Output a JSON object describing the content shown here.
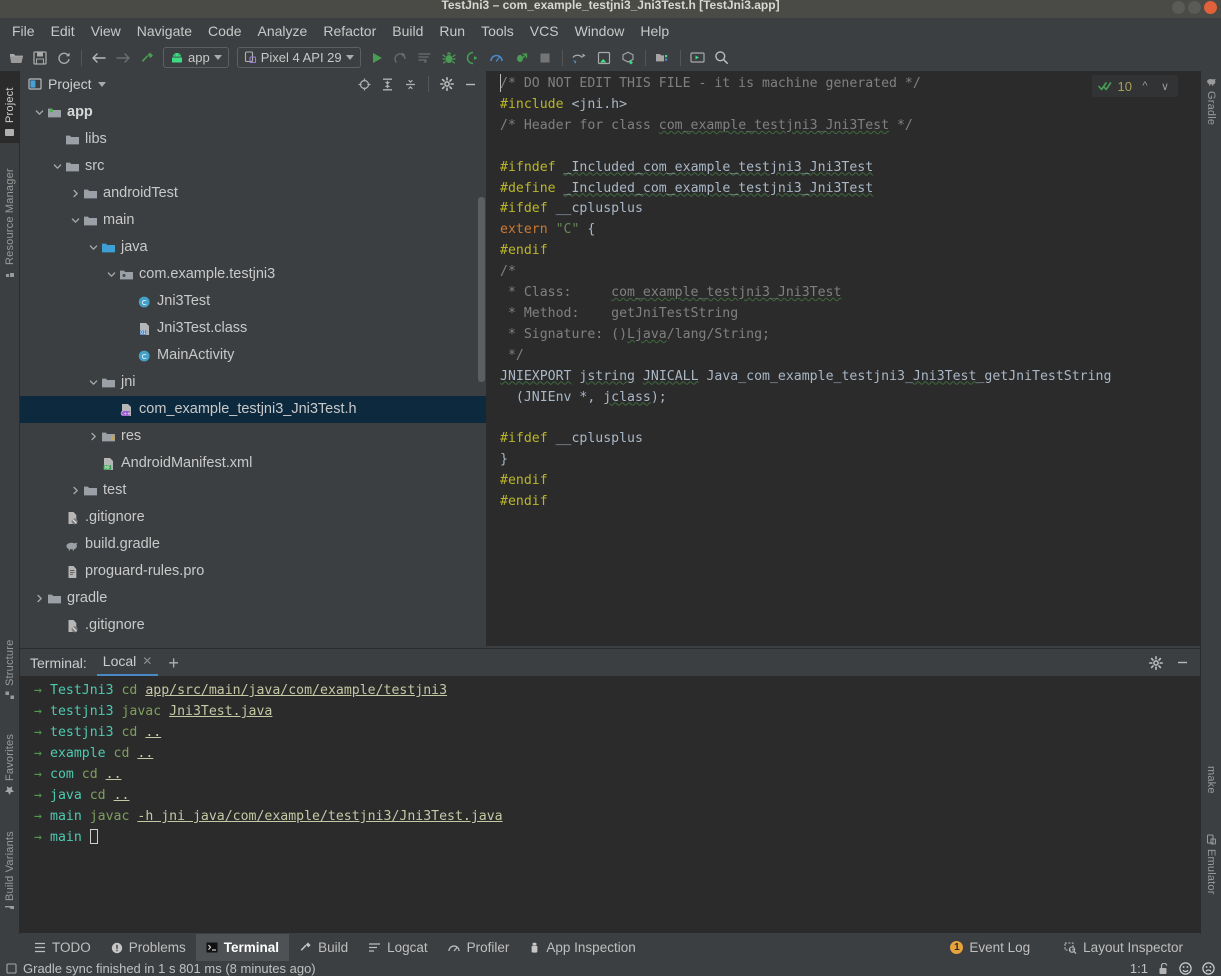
{
  "window": {
    "title": "TestJni3 – com_example_testjni3_Jni3Test.h [TestJni3.app]"
  },
  "menubar": {
    "items": [
      "File",
      "Edit",
      "View",
      "Navigate",
      "Code",
      "Analyze",
      "Refactor",
      "Build",
      "Run",
      "Tools",
      "VCS",
      "Window",
      "Help"
    ]
  },
  "toolbar": {
    "open_icon": "open-folder-icon",
    "save_icon": "save-icon",
    "sync_icon": "sync-icon",
    "back_icon": "back-arrow-icon",
    "forward_icon": "forward-arrow-icon",
    "build_icon": "hammer-icon",
    "module_selector": "app",
    "device_selector": "Pixel 4 API 29",
    "run_icon": "run-icon",
    "rerun_icon": "rerun-icon",
    "apply_changes_icon": "apply-changes-icon",
    "debug_icon": "debug-icon",
    "attach_debugger_icon": "attach-debugger-icon",
    "profiler_icon": "profiler-icon",
    "apply_code_changes_icon": "apply-code-changes-icon",
    "stop_icon": "stop-icon",
    "avd_manager_icon": "avd-manager-icon",
    "sdk_manager_icon": "sdk-manager-icon",
    "gradle_sync_icon": "gradle-sync-icon",
    "project_structure_icon": "project-structure-icon",
    "layout_editor_icon": "layout-editor-icon",
    "search_icon": "search-icon"
  },
  "left_tool_tabs": [
    {
      "label": "Project",
      "icon": "project-icon",
      "active": true
    },
    {
      "label": "Resource Manager",
      "icon": "resource-manager-icon",
      "active": false
    },
    {
      "label": "Structure",
      "icon": "structure-icon",
      "active": false
    },
    {
      "label": "Favorites",
      "icon": "star-icon",
      "active": false
    },
    {
      "label": "Build Variants",
      "icon": "build-variants-icon",
      "active": false
    }
  ],
  "right_tool_tabs": [
    {
      "label": "Gradle",
      "icon": "gradle-elephant-icon"
    },
    {
      "label": "make",
      "icon": "make-icon"
    },
    {
      "label": "Emulator",
      "icon": "emulator-icon"
    }
  ],
  "project_panel": {
    "title": "Project",
    "dropdown_icon": "chevron-down-icon",
    "header_icons": [
      {
        "name": "locate-icon"
      },
      {
        "name": "expand-all-icon"
      },
      {
        "name": "collapse-all-icon"
      },
      {
        "name": "gear-icon"
      },
      {
        "name": "hide-icon"
      }
    ],
    "tree": [
      {
        "label": "app",
        "depth": 1,
        "arrow": "down",
        "icon": "module-folder-icon",
        "bold": true,
        "selected": false
      },
      {
        "label": "libs",
        "depth": 2,
        "arrow": "none",
        "icon": "folder-icon",
        "bold": false,
        "selected": false
      },
      {
        "label": "src",
        "depth": 2,
        "arrow": "down",
        "icon": "folder-icon",
        "bold": false,
        "selected": false
      },
      {
        "label": "androidTest",
        "depth": 3,
        "arrow": "right",
        "icon": "folder-icon",
        "bold": false,
        "selected": false
      },
      {
        "label": "main",
        "depth": 3,
        "arrow": "down",
        "icon": "folder-icon",
        "bold": false,
        "selected": false
      },
      {
        "label": "java",
        "depth": 4,
        "arrow": "down",
        "icon": "source-folder-icon",
        "bold": false,
        "selected": false
      },
      {
        "label": "com.example.testjni3",
        "depth": 5,
        "arrow": "down",
        "icon": "package-icon",
        "bold": false,
        "selected": false
      },
      {
        "label": "Jni3Test",
        "depth": 6,
        "arrow": "none",
        "icon": "java-class-icon",
        "bold": false,
        "selected": false
      },
      {
        "label": "Jni3Test.class",
        "depth": 6,
        "arrow": "none",
        "icon": "class-file-icon",
        "bold": false,
        "selected": false
      },
      {
        "label": "MainActivity",
        "depth": 6,
        "arrow": "none",
        "icon": "java-class-icon",
        "bold": false,
        "selected": false
      },
      {
        "label": "jni",
        "depth": 4,
        "arrow": "down",
        "icon": "folder-icon",
        "bold": false,
        "selected": false
      },
      {
        "label": "com_example_testjni3_Jni3Test.h",
        "depth": 5,
        "arrow": "none",
        "icon": "cpp-header-icon",
        "bold": false,
        "selected": true
      },
      {
        "label": "res",
        "depth": 4,
        "arrow": "right",
        "icon": "res-folder-icon",
        "bold": false,
        "selected": false
      },
      {
        "label": "AndroidManifest.xml",
        "depth": 4,
        "arrow": "none",
        "icon": "manifest-icon",
        "bold": false,
        "selected": false
      },
      {
        "label": "test",
        "depth": 3,
        "arrow": "right",
        "icon": "folder-icon",
        "bold": false,
        "selected": false
      },
      {
        "label": ".gitignore",
        "depth": 2,
        "arrow": "none",
        "icon": "gitignore-icon",
        "bold": false,
        "selected": false
      },
      {
        "label": "build.gradle",
        "depth": 2,
        "arrow": "none",
        "icon": "gradle-file-icon",
        "bold": false,
        "selected": false
      },
      {
        "label": "proguard-rules.pro",
        "depth": 2,
        "arrow": "none",
        "icon": "text-file-icon",
        "bold": false,
        "selected": false
      },
      {
        "label": "gradle",
        "depth": 1,
        "arrow": "right",
        "icon": "folder-icon",
        "bold": false,
        "selected": false
      },
      {
        "label": ".gitignore",
        "depth": 2,
        "arrow": "none",
        "icon": "gitignore-icon",
        "bold": false,
        "selected": false
      }
    ]
  },
  "editor": {
    "inspection_count": "10",
    "inspection_icon": "inspection-ok-icon",
    "prev_icon": "chevron-up-icon",
    "next_icon": "chevron-down-icon",
    "lines": [
      "/* DO NOT EDIT THIS FILE - it is machine generated */",
      "#include <jni.h>",
      "/* Header for class com_example_testjni3_Jni3Test */",
      "",
      "#ifndef _Included_com_example_testjni3_Jni3Test",
      "#define _Included_com_example_testjni3_Jni3Test",
      "#ifdef __cplusplus",
      "extern \"C\" {",
      "#endif",
      "/*",
      " * Class:     com_example_testjni3_Jni3Test",
      " * Method:    getJniTestString",
      " * Signature: ()Ljava/lang/String;",
      " */",
      "JNIEXPORT jstring JNICALL Java_com_example_testjni3_Jni3Test_getJniTestString",
      "  (JNIEnv *, jclass);",
      "",
      "#ifdef __cplusplus",
      "}",
      "#endif",
      "#endif"
    ]
  },
  "terminal": {
    "label": "Terminal:",
    "tab": "Local",
    "close_icon": "close-icon",
    "add_icon": "plus-icon",
    "settings_icon": "gear-icon",
    "hide_icon": "hide-icon",
    "prompt_symbol": "→",
    "lines": [
      {
        "dir": "TestJni3",
        "cmd": "cd",
        "arg": "app/src/main/java/com/example/testjni3",
        "arg_link": true
      },
      {
        "dir": "testjni3",
        "cmd": "javac",
        "arg": "Jni3Test.java",
        "arg_link": true
      },
      {
        "dir": "testjni3",
        "cmd": "cd",
        "arg": "..",
        "arg_link": true
      },
      {
        "dir": "example",
        "cmd": "cd",
        "arg": "..",
        "arg_link": true
      },
      {
        "dir": "com",
        "cmd": "cd",
        "arg": "..",
        "arg_link": true
      },
      {
        "dir": "java",
        "cmd": "cd",
        "arg": "..",
        "arg_link": true
      },
      {
        "dir": "main",
        "cmd": "javac",
        "arg": "-h jni java/com/example/testjni3/Jni3Test.java",
        "arg_link": true
      },
      {
        "dir": "main",
        "cmd": "",
        "arg": "",
        "arg_link": false
      }
    ]
  },
  "bottom_bar": {
    "tabs": [
      {
        "label": "TODO",
        "icon": "todo-icon",
        "active": false
      },
      {
        "label": "Problems",
        "icon": "problems-icon",
        "active": false
      },
      {
        "label": "Terminal",
        "icon": "terminal-icon",
        "active": true
      },
      {
        "label": "Build",
        "icon": "build-hammer-icon",
        "active": false
      },
      {
        "label": "Logcat",
        "icon": "logcat-icon",
        "active": false
      },
      {
        "label": "Profiler",
        "icon": "profiler-icon",
        "active": false
      },
      {
        "label": "App Inspection",
        "icon": "app-inspection-icon",
        "active": false
      }
    ],
    "right": [
      {
        "label": "Event Log",
        "icon": "event-log-icon",
        "badge": "1"
      },
      {
        "label": "Layout Inspector",
        "icon": "layout-inspector-icon",
        "badge": ""
      }
    ]
  },
  "statusbar": {
    "message": "Gradle sync finished in 1 s 801 ms (8 minutes ago)",
    "message_icon": "event-icon",
    "caret_position": "1:1",
    "lock_icon": "unlocked-icon",
    "happy_icon": "happy-face-icon",
    "sad_icon": "sad-face-icon"
  },
  "colors": {
    "bg_panel": "#3c3f41",
    "bg_editor": "#2b2b2b",
    "selection": "#0d293e",
    "accent_green": "#499c54",
    "accent_blue": "#4a88c7",
    "preproc_yellow": "#bbb529",
    "comment_gray": "#808080",
    "string_green": "#6a8759",
    "keyword_orange": "#cc7832",
    "badge_orange": "#e8a33d"
  }
}
